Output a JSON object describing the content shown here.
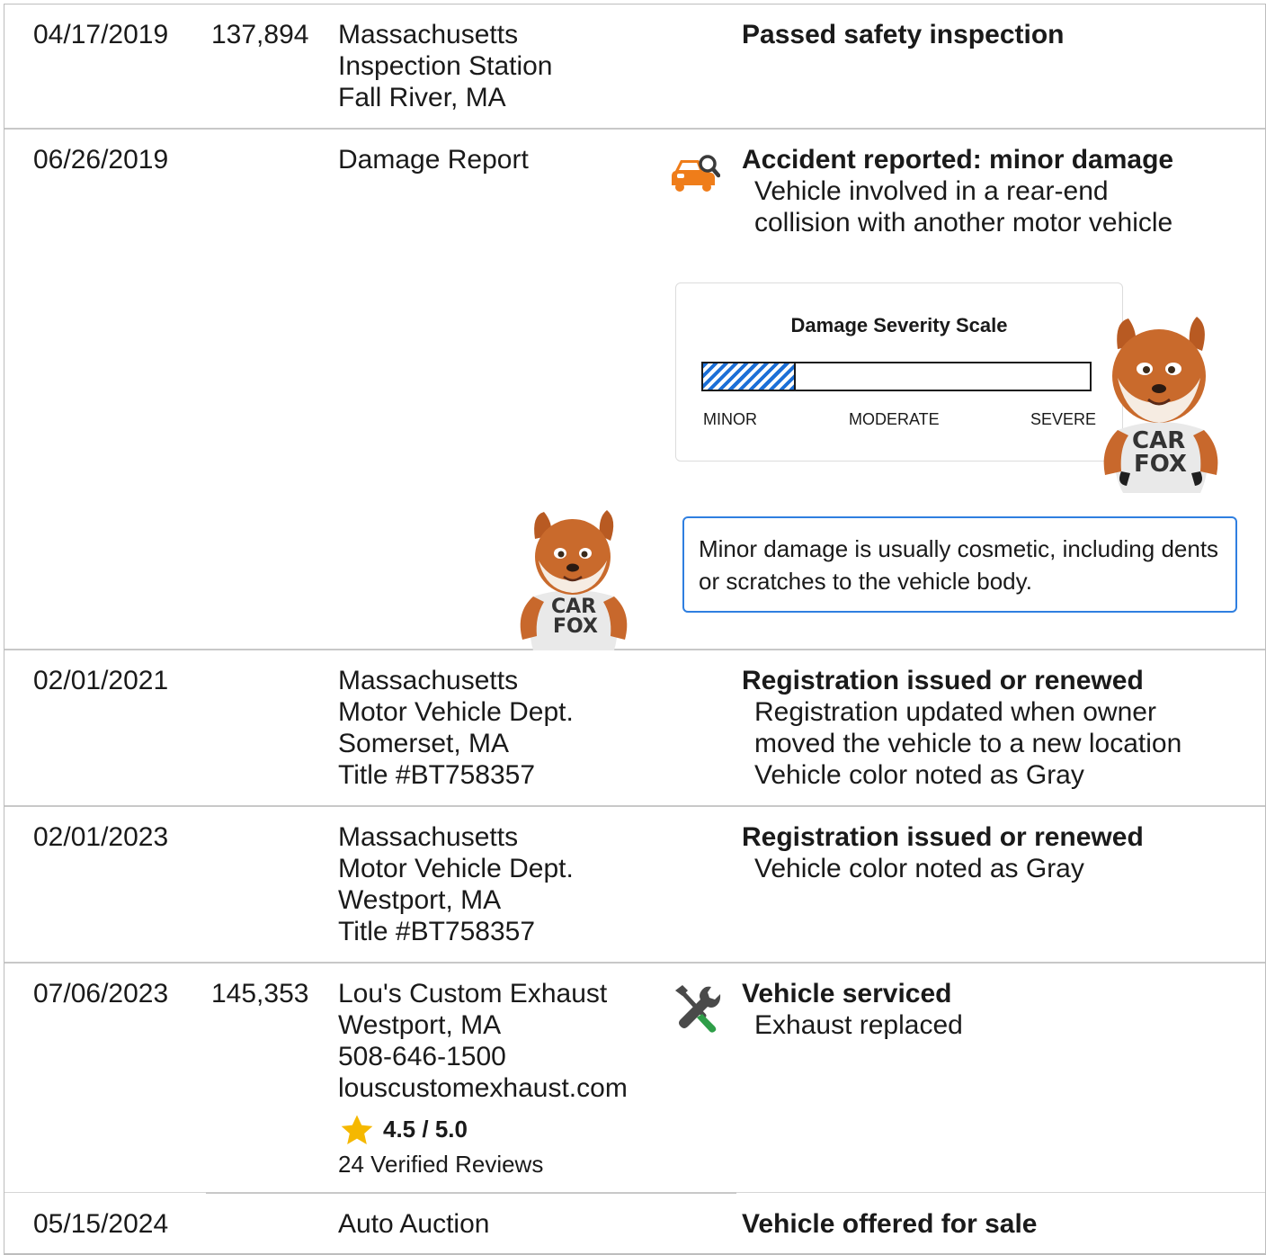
{
  "records": [
    {
      "date": "04/17/2019",
      "odometer": "137,894",
      "source": [
        "Massachusetts",
        "Inspection Station",
        "Fall River, MA"
      ],
      "event_title": "Passed safety inspection",
      "event_details": []
    },
    {
      "date": "06/26/2019",
      "odometer": "",
      "source": [
        "Damage Report"
      ],
      "icon": "car-damage-search-icon",
      "event_title": "Accident reported: minor damage",
      "event_details": [
        "Vehicle involved in a rear-end",
        "collision with another motor vehicle"
      ]
    },
    {
      "date": "02/01/2021",
      "odometer": "",
      "source": [
        "Massachusetts",
        "Motor Vehicle Dept.",
        "Somerset, MA",
        "Title #BT758357"
      ],
      "event_title": "Registration issued or renewed",
      "event_details": [
        "Registration updated when owner",
        "moved the vehicle to a new location",
        "Vehicle color noted as Gray"
      ]
    },
    {
      "date": "02/01/2023",
      "odometer": "",
      "source": [
        "Massachusetts",
        "Motor Vehicle Dept.",
        "Westport, MA",
        "Title #BT758357"
      ],
      "event_title": "Registration issued or renewed",
      "event_details": [
        "Vehicle color noted as Gray"
      ]
    },
    {
      "date": "07/06/2023",
      "odometer": "145,353",
      "source": [
        "Lou's Custom Exhaust",
        "Westport, MA",
        "508-646-1500",
        "louscustomexhaust.com"
      ],
      "icon": "wrench-screwdriver-icon",
      "event_title": "Vehicle serviced",
      "event_details": [
        "Exhaust replaced"
      ],
      "rating": "4.5 / 5.0",
      "reviews": "24 Verified Reviews"
    },
    {
      "date": "05/15/2024",
      "odometer": "",
      "source": [
        "Auto Auction"
      ],
      "event_title": "Vehicle offered for sale",
      "event_details": []
    }
  ],
  "severity": {
    "title": "Damage Severity Scale",
    "labels": [
      "MINOR",
      "MODERATE",
      "SEVERE"
    ],
    "level_fraction": 0.24,
    "fill_color": "#1c6fd6"
  },
  "note": "Minor damage is usually cosmetic, including dents or scratches to the vehicle body.",
  "mascot_shirt": [
    "CAR",
    "FOX"
  ],
  "colors": {
    "damage_icon": "#ef7d1a",
    "service_green": "#2e9e48",
    "star": "#f5b800",
    "note_border": "#2f7fe0"
  }
}
